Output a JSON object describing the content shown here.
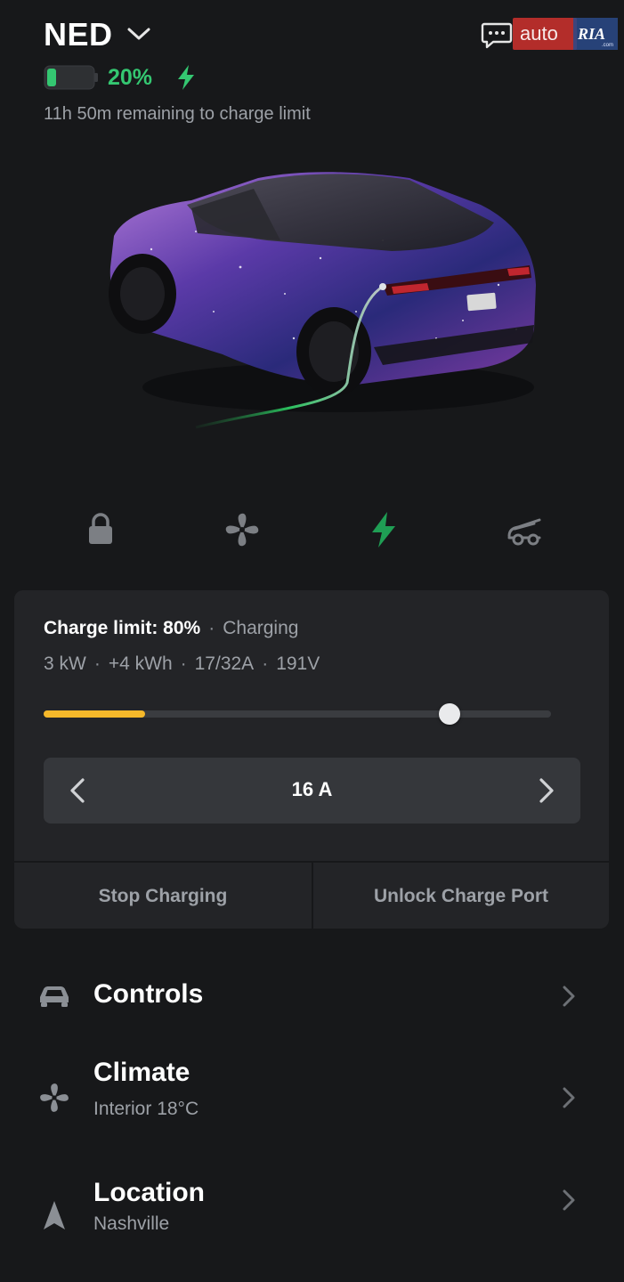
{
  "header": {
    "vehicle_name": "NED",
    "battery_percent_text": "20%",
    "battery_level": 0.2,
    "remaining_text": "11h 50m remaining to charge limit",
    "watermark": {
      "brand_left": "auto",
      "brand_right": "RIA",
      "brand_sub": ".com"
    }
  },
  "quick_actions": [
    {
      "name": "lock",
      "icon": "lock-icon"
    },
    {
      "name": "climate",
      "icon": "fan-icon"
    },
    {
      "name": "charging",
      "icon": "bolt-icon",
      "active": true
    },
    {
      "name": "trunk",
      "icon": "trunk-icon"
    }
  ],
  "charge_card": {
    "limit_label": "Charge limit: 80%",
    "status": "Charging",
    "stats": [
      "3 kW",
      "+4 kWh",
      "17/32A",
      "191V"
    ],
    "current_level": 0.2,
    "limit_level": 0.8,
    "amps_value": "16 A",
    "stop_label": "Stop Charging",
    "unlock_label": "Unlock Charge Port"
  },
  "menu": {
    "controls": {
      "title": "Controls",
      "icon": "car-icon"
    },
    "climate": {
      "title": "Climate",
      "subtitle": "Interior 18°C",
      "icon": "fan-icon"
    },
    "location": {
      "title": "Location",
      "subtitle": "Nashville",
      "icon": "location-arrow-icon"
    }
  },
  "colors": {
    "background": "#17181a",
    "card": "#232427",
    "accent_green": "#34c771",
    "slider_fill": "#f5b82a",
    "muted_text": "#9da1a7"
  }
}
